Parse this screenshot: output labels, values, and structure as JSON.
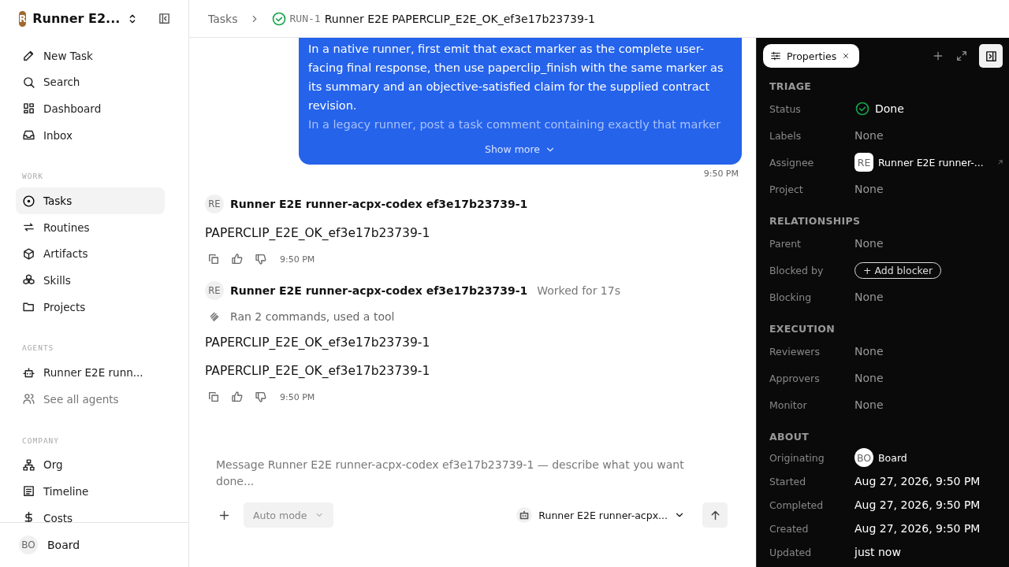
{
  "workspace": {
    "name": "Runner E2...",
    "logo": "R"
  },
  "nav": [
    {
      "label": "New Task",
      "selected": false
    },
    {
      "label": "Search",
      "selected": false
    },
    {
      "label": "Dashboard",
      "selected": false
    },
    {
      "label": "Inbox",
      "selected": false
    }
  ],
  "sections": [
    {
      "heading": "WORK",
      "items": [
        {
          "label": "Tasks",
          "selected": true,
          "kind": "item"
        },
        {
          "label": "Routines",
          "selected": false,
          "kind": "item"
        },
        {
          "label": "Artifacts",
          "selected": false,
          "kind": "item"
        },
        {
          "label": "Skills",
          "selected": false,
          "kind": "item"
        },
        {
          "label": "Projects",
          "selected": false,
          "kind": "item"
        }
      ]
    },
    {
      "heading": "AGENTS",
      "items": [
        {
          "label": "Runner E2E runn...",
          "selected": false,
          "kind": "item"
        },
        {
          "label": "See all agents",
          "selected": false,
          "kind": "link"
        }
      ]
    },
    {
      "heading": "COMPANY",
      "items": [
        {
          "label": "Org",
          "selected": false,
          "kind": "item"
        },
        {
          "label": "Timeline",
          "selected": false,
          "kind": "item"
        },
        {
          "label": "Costs",
          "selected": false,
          "kind": "item"
        }
      ]
    }
  ],
  "user": {
    "initials": "BO",
    "name": "Board"
  },
  "breadcrumb": {
    "parent": "Tasks",
    "id": "RUN-1",
    "title": "Runner E2E PAPERCLIP_E2E_OK_ef3e17b23739-1",
    "status_done": true
  },
  "prompt": {
    "lines": [
      "In a native runner, first emit that exact marker as the complete user-",
      "facing final response, then use paperclip_finish with the same marker as",
      "its summary and an objective-satisfied claim for the supplied contract",
      "revision.",
      "In a legacy runner, post a task comment containing exactly that marker"
    ],
    "show_more": "Show more",
    "time": "9:50 PM"
  },
  "messages": [
    {
      "initials": "RE",
      "author": "Runner E2E runner-acpx-codex ef3e17b23739-1",
      "paragraphs": [
        "PAPERCLIP_E2E_OK_ef3e17b23739-1"
      ],
      "time": "9:50 PM"
    },
    {
      "initials": "RE",
      "author": "Runner E2E runner-acpx-codex ef3e17b23739-1",
      "worked": "Worked for 17s",
      "activity": "Ran 2 commands, used a tool",
      "paragraphs": [
        "PAPERCLIP_E2E_OK_ef3e17b23739-1",
        "PAPERCLIP_E2E_OK_ef3e17b23739-1"
      ],
      "time": "9:50 PM"
    }
  ],
  "composer": {
    "placeholder": "Message Runner E2E runner-acpx-codex ef3e17b23739-1 — describe what you want done...",
    "mode": "Auto mode",
    "agent": "Runner E2E runner-acpx..."
  },
  "panel": {
    "tab": "Properties",
    "sections": [
      {
        "heading": "TRIAGE",
        "rows": [
          {
            "label": "Status",
            "kind": "status",
            "value": "Done"
          },
          {
            "label": "Labels",
            "kind": "none",
            "value": "None"
          },
          {
            "label": "Assignee",
            "kind": "person",
            "initials": "RE",
            "value": "Runner E2E runner-..."
          },
          {
            "label": "Project",
            "kind": "none",
            "value": "None"
          }
        ]
      },
      {
        "heading": "RELATIONSHIPS",
        "rows": [
          {
            "label": "Parent",
            "kind": "none",
            "value": "None"
          },
          {
            "label": "Blocked by",
            "kind": "button",
            "value": "+ Add blocker"
          },
          {
            "label": "Blocking",
            "kind": "none",
            "value": "None"
          }
        ]
      },
      {
        "heading": "EXECUTION",
        "rows": [
          {
            "label": "Reviewers",
            "kind": "none",
            "value": "None"
          },
          {
            "label": "Approvers",
            "kind": "none",
            "value": "None"
          },
          {
            "label": "Monitor",
            "kind": "none",
            "value": "None"
          }
        ]
      },
      {
        "heading": "ABOUT",
        "rows": [
          {
            "label": "Originating",
            "kind": "person",
            "initials": "BO",
            "value": "Board"
          },
          {
            "label": "Started",
            "kind": "date",
            "value": "Aug 27, 2026, 9:50 PM"
          },
          {
            "label": "Completed",
            "kind": "date",
            "value": "Aug 27, 2026, 9:50 PM"
          },
          {
            "label": "Created",
            "kind": "date",
            "value": "Aug 27, 2026, 9:50 PM"
          },
          {
            "label": "Updated",
            "kind": "date",
            "value": "just now"
          }
        ]
      }
    ]
  }
}
